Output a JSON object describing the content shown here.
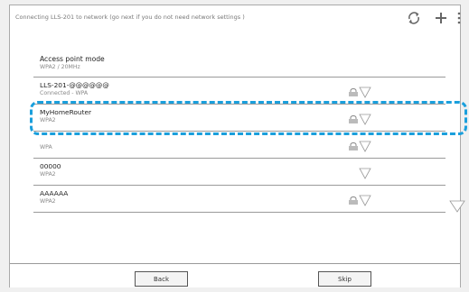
{
  "title": "Connecting LLS-201 to network (go next if you do not need network settings )",
  "header_icons": [
    "refresh-icon",
    "add-icon",
    "more-icon"
  ],
  "networks": [
    {
      "name": "Access point mode",
      "security": "WPA2 / 20MHz",
      "locked": false,
      "signal": false
    },
    {
      "name": "LLS-201-@@@@@@",
      "security": "Connected - WPA",
      "locked": true,
      "signal": true
    },
    {
      "name": "MyHomeRouter",
      "security": "WPA2",
      "locked": true,
      "signal": true
    },
    {
      "name": "",
      "security": "WPA",
      "locked": true,
      "signal": true
    },
    {
      "name": "00000",
      "security": "WPA2",
      "locked": false,
      "signal": true
    },
    {
      "name": "AAAAAA",
      "security": "WPA2",
      "locked": true,
      "signal": true
    }
  ],
  "footer": {
    "back_label": "Back",
    "skip_label": "Skip"
  },
  "colors": {
    "highlight": "#1a9fdc",
    "accent": "#1a9fdc",
    "frame": "#aaaaaa"
  }
}
